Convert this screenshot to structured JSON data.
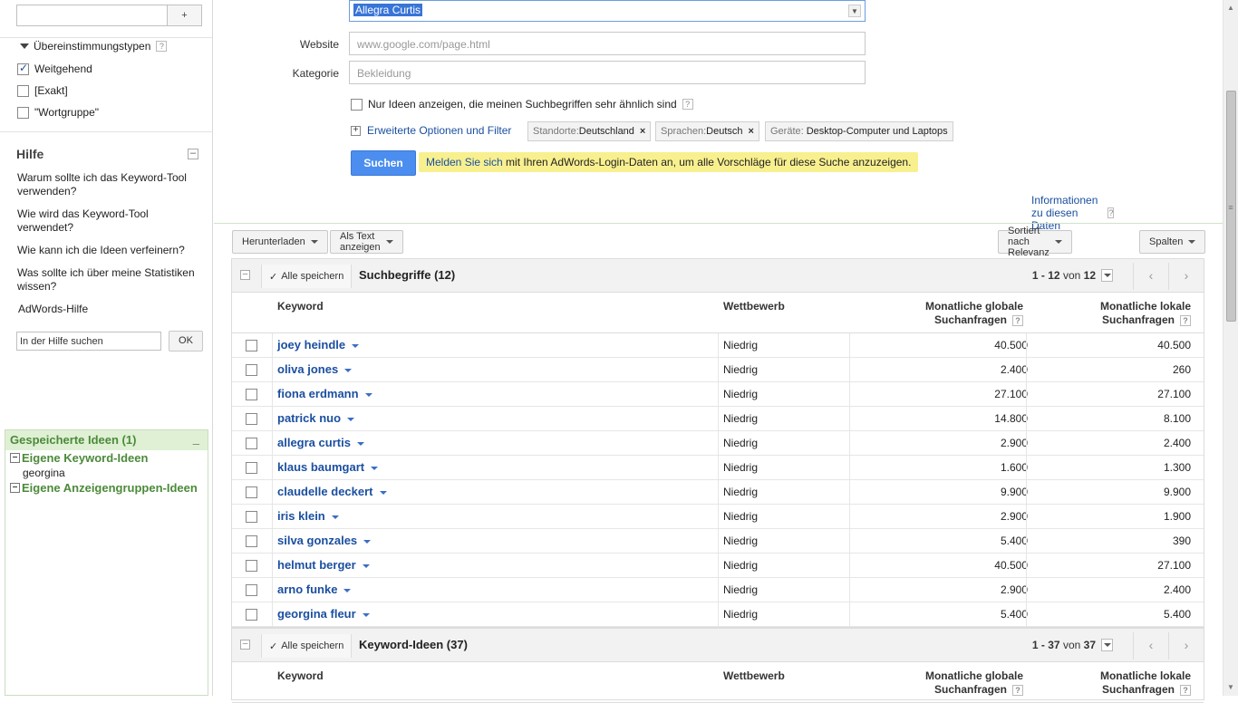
{
  "sidebar": {
    "search_plus": "+",
    "match_types_title": "Übereinstimmungstypen",
    "match_types": [
      {
        "label": "Weitgehend",
        "checked": true
      },
      {
        "label": "[Exakt]",
        "checked": false
      },
      {
        "label": "\"Wortgruppe\"",
        "checked": false
      }
    ],
    "help_title": "Hilfe",
    "help_links": [
      "Warum sollte ich das Keyword-Tool verwenden?",
      "Wie wird das Keyword-Tool verwendet?",
      "Wie kann ich die Ideen verfeinern?",
      "Was sollte ich über meine Statistiken wissen?",
      "AdWords-Hilfe"
    ],
    "help_search_placeholder": "In der Hilfe suchen",
    "ok_label": "OK",
    "saved_title": "Gespeicherte Ideen (1)",
    "saved_keywords_title": "Eigene Keyword-Ideen",
    "saved_keywords": [
      "georgina"
    ],
    "saved_adgroups_title": "Eigene Anzeigengruppen-Ideen"
  },
  "form": {
    "word_value": "Allegra Curtis",
    "website_label": "Website",
    "website_placeholder": "www.google.com/page.html",
    "category_label": "Kategorie",
    "category_placeholder": "Bekleidung",
    "similar_label": "Nur Ideen anzeigen, die meinen Suchbegriffen sehr ähnlich sind",
    "advanced_label": "Erweiterte Optionen und Filter",
    "chips": [
      {
        "label": "Standorte:",
        "value": "Deutschland",
        "close": "×"
      },
      {
        "label": "Sprachen:",
        "value": "Deutsch",
        "close": "×"
      },
      {
        "label": "Geräte:",
        "value": "Desktop-Computer und Laptops",
        "close": ""
      }
    ],
    "search_button": "Suchen",
    "signin_link": "Melden Sie sich",
    "signin_text": " mit Ihren AdWords-Login-Daten an, um alle Vorschläge für diese Suche anzuzeigen.",
    "info_link": "Informationen zu diesen Daten"
  },
  "toolbar": {
    "download": "Herunterladen",
    "text_view": "Als Text anzeigen",
    "sort": "Sortiert nach Relevanz",
    "columns": "Spalten"
  },
  "columns": {
    "keyword": "Keyword",
    "competition": "Wettbewerb",
    "global_1": "Monatliche globale",
    "global_2": "Suchanfragen",
    "local_1": "Monatliche lokale",
    "local_2": "Suchanfragen"
  },
  "table1": {
    "save_all": "Alle speichern",
    "title": "Suchbegriffe (12)",
    "range": "1 - 12",
    "of": "von",
    "total": "12",
    "rows": [
      {
        "keyword": "joey heindle",
        "competition": "Niedrig",
        "global": "40.500",
        "local": "40.500"
      },
      {
        "keyword": "oliva jones",
        "competition": "Niedrig",
        "global": "2.400",
        "local": "260"
      },
      {
        "keyword": "fiona erdmann",
        "competition": "Niedrig",
        "global": "27.100",
        "local": "27.100"
      },
      {
        "keyword": "patrick nuo",
        "competition": "Niedrig",
        "global": "14.800",
        "local": "8.100"
      },
      {
        "keyword": "allegra curtis",
        "competition": "Niedrig",
        "global": "2.900",
        "local": "2.400"
      },
      {
        "keyword": "klaus baumgart",
        "competition": "Niedrig",
        "global": "1.600",
        "local": "1.300"
      },
      {
        "keyword": "claudelle deckert",
        "competition": "Niedrig",
        "global": "9.900",
        "local": "9.900"
      },
      {
        "keyword": "iris klein",
        "competition": "Niedrig",
        "global": "2.900",
        "local": "1.900"
      },
      {
        "keyword": "silva gonzales",
        "competition": "Niedrig",
        "global": "5.400",
        "local": "390"
      },
      {
        "keyword": "helmut berger",
        "competition": "Niedrig",
        "global": "40.500",
        "local": "27.100"
      },
      {
        "keyword": "arno funke",
        "competition": "Niedrig",
        "global": "2.900",
        "local": "2.400"
      },
      {
        "keyword": "georgina fleur",
        "competition": "Niedrig",
        "global": "5.400",
        "local": "5.400"
      }
    ]
  },
  "table2": {
    "save_all": "Alle speichern",
    "title": "Keyword-Ideen (37)",
    "range": "1 - 37",
    "of": "von",
    "total": "37"
  }
}
